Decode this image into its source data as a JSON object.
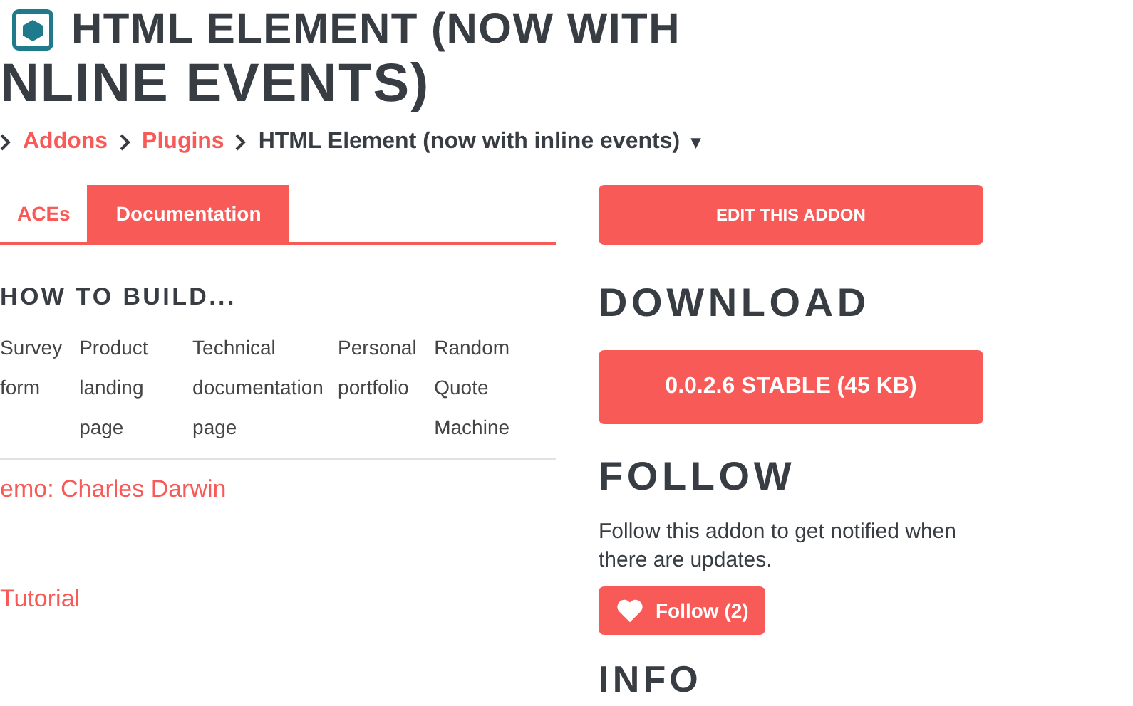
{
  "title": {
    "line_1": "HTML ELEMENT (NOW WITH",
    "line_2": "NLINE EVENTS)"
  },
  "breadcrumb": [
    {
      "label": "Addons",
      "kind": "link"
    },
    {
      "label": "Plugins",
      "kind": "link"
    },
    {
      "label": "HTML Element (now with inline events)",
      "kind": "current"
    }
  ],
  "breadcrumb_caret": "▾",
  "tabs": [
    {
      "label": "ACEs",
      "selected": false
    },
    {
      "label": "Documentation",
      "selected": true
    }
  ],
  "how_to_build": {
    "heading": "HOW TO BUILD...",
    "items": [
      "Survey form",
      "Product landing page",
      "Technical documentation page",
      "Personal portfolio",
      "Random Quote Machine"
    ]
  },
  "links": [
    "emo: Charles Darwin",
    "Tutorial"
  ],
  "sidebar": {
    "edit_button": "EDIT THIS ADDON",
    "download_heading": "DOWNLOAD",
    "download_button": "0.0.2.6 STABLE (45 KB)",
    "follow_heading": "FOLLOW",
    "follow_text": "Follow this addon to get notified when there are updates.",
    "follow_button": "Follow (2)",
    "info_heading": "INFO"
  }
}
